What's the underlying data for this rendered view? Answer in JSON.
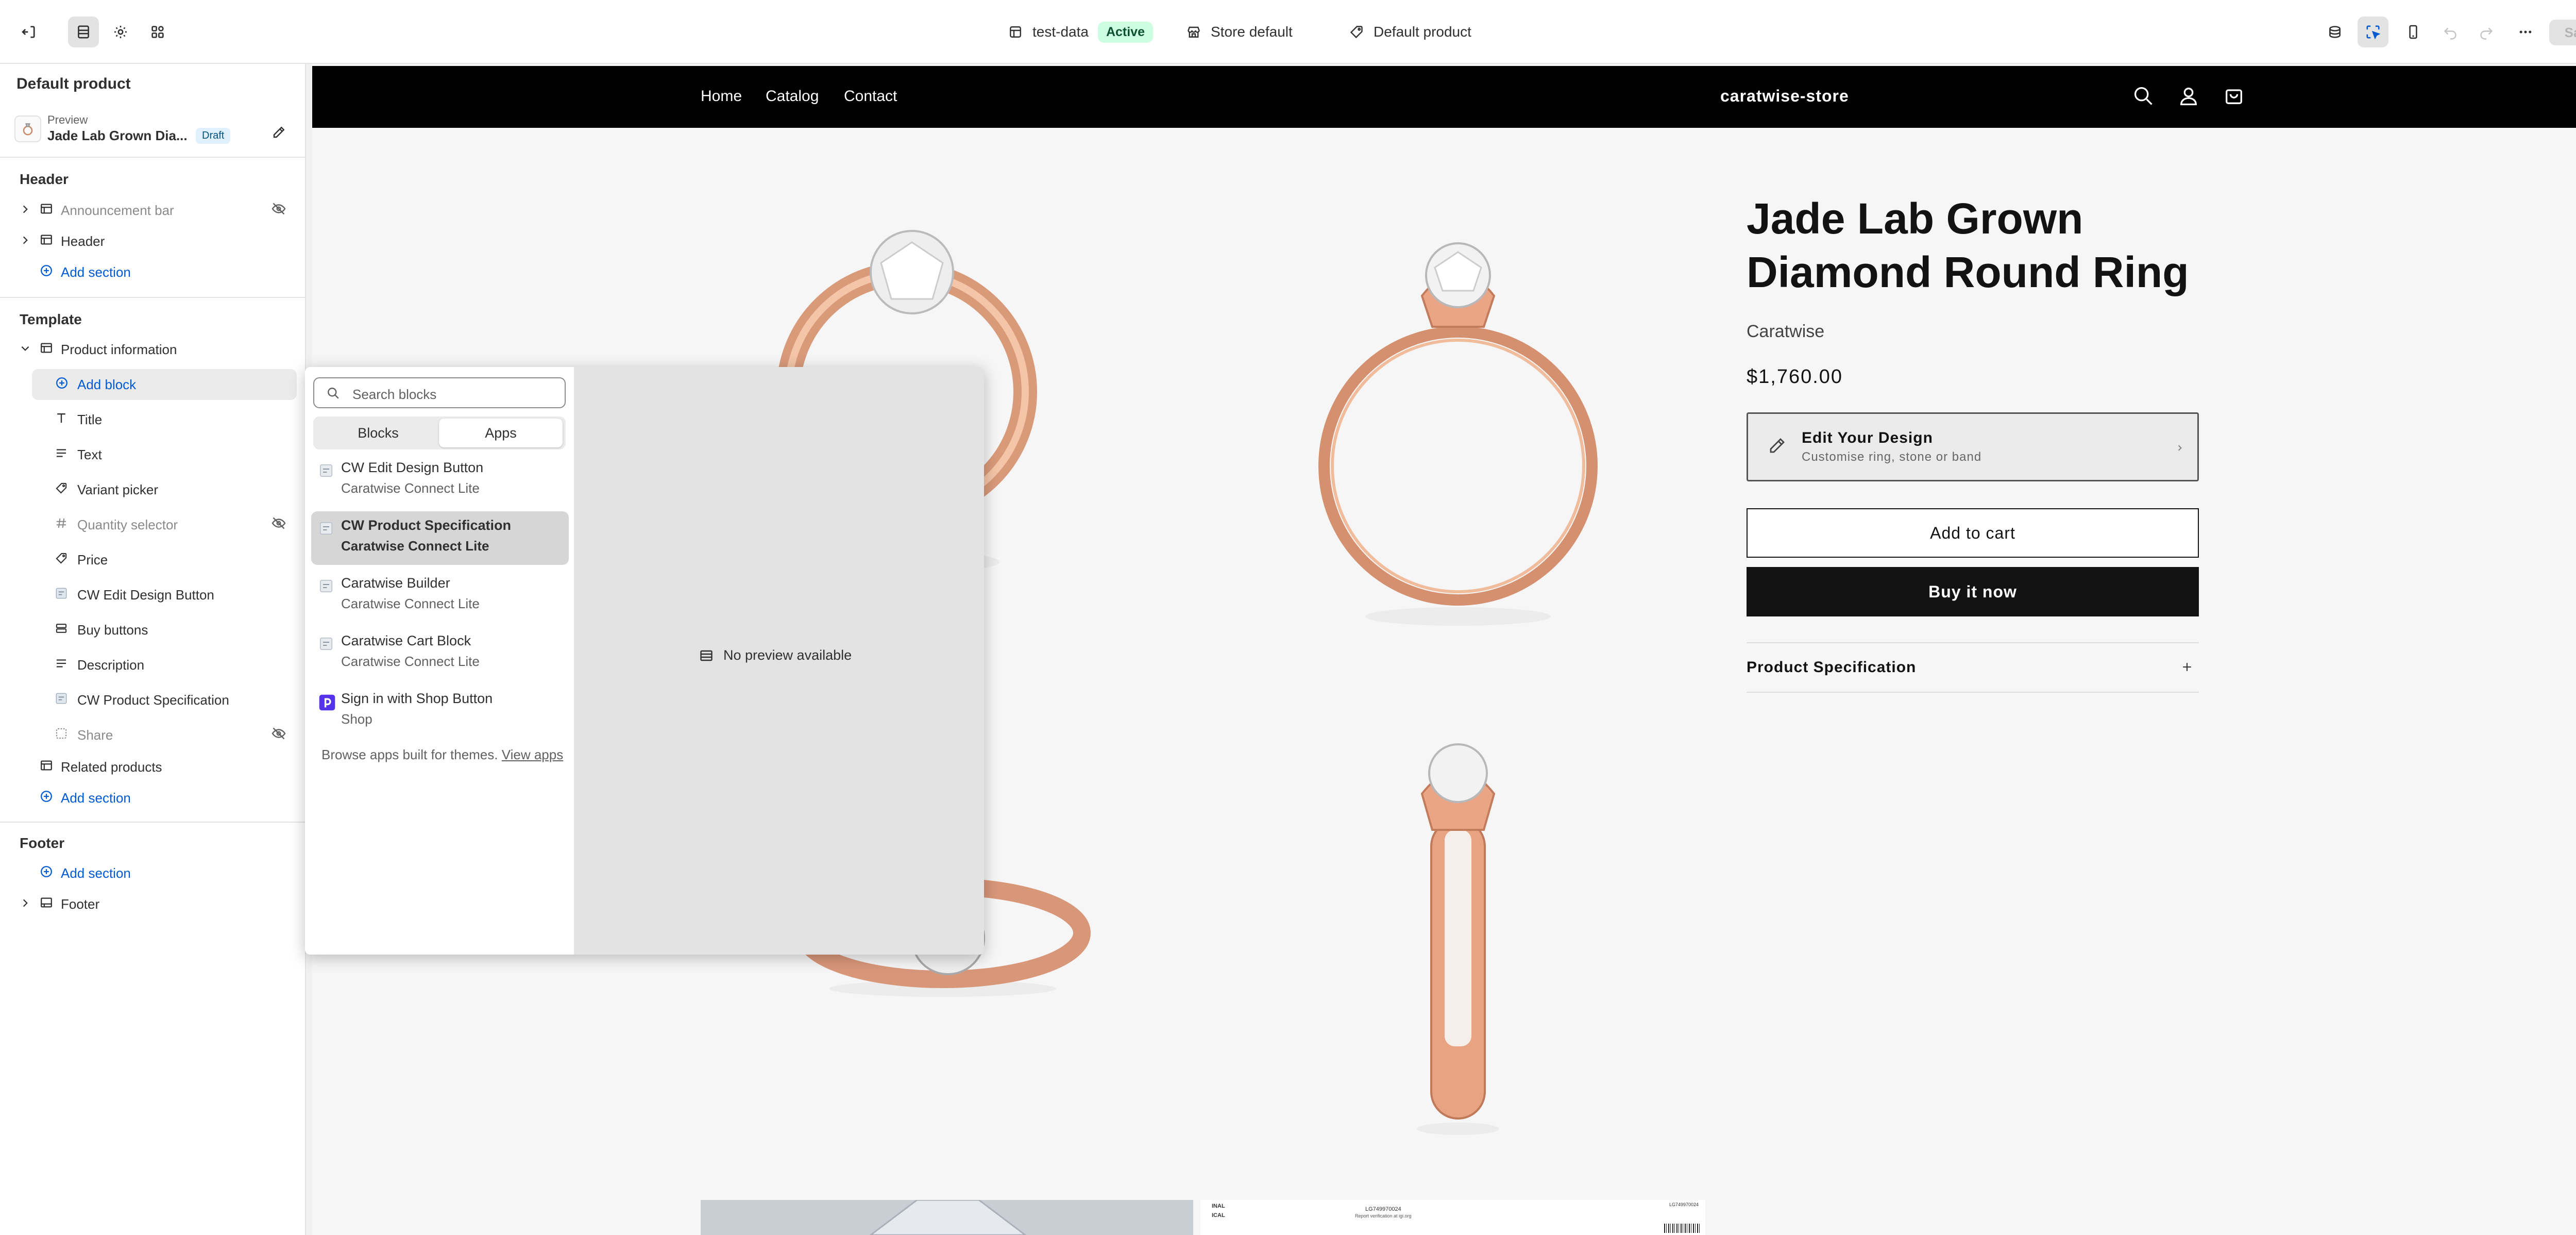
{
  "topbar": {
    "theme_name": "test-data",
    "theme_status": "Active",
    "store_label": "Store default",
    "template_label": "Default product",
    "save_label": "Save"
  },
  "sidebar": {
    "title": "Default product",
    "preview_label": "Preview",
    "preview_product": "Jade Lab Grown Dia...",
    "preview_status": "Draft",
    "header_section": {
      "heading": "Header",
      "items": [
        "Announcement bar",
        "Header"
      ],
      "add_section": "Add section"
    },
    "template_section": {
      "heading": "Template",
      "product_information": "Product information",
      "add_block": "Add block",
      "blocks": [
        "Title",
        "Text",
        "Variant picker",
        "Quantity selector",
        "Price",
        "CW Edit Design Button",
        "Buy buttons",
        "Description",
        "CW Product Specification",
        "Share"
      ],
      "related_products": "Related products",
      "add_section": "Add section"
    },
    "footer_section": {
      "heading": "Footer",
      "add_section": "Add section",
      "items": [
        "Footer"
      ]
    }
  },
  "store": {
    "nav": [
      "Home",
      "Catalog",
      "Contact"
    ],
    "name": "caratwise-store",
    "product_title": "Jade Lab Grown Diamond Round Ring",
    "vendor": "Caratwise",
    "price": "$1,760.00",
    "edit_title": "Edit Your Design",
    "edit_subtitle": "Customise ring, stone or band",
    "add_to_cart": "Add to cart",
    "buy_now": "Buy it now",
    "spec_label": "Product Specification",
    "cert_lines": [
      "INAL",
      "ICAL",
      "LG749970024",
      "Report verification at igi.org",
      "LG749970024"
    ]
  },
  "picker": {
    "search_placeholder": "Search blocks",
    "tabs": [
      "Blocks",
      "Apps"
    ],
    "items": [
      {
        "name": "CW Edit Design Button",
        "app": "Caratwise Connect Lite"
      },
      {
        "name": "CW Product Specification",
        "app": "Caratwise Connect Lite"
      },
      {
        "name": "Caratwise Builder",
        "app": "Caratwise Connect Lite"
      },
      {
        "name": "Caratwise Cart Block",
        "app": "Caratwise Connect Lite"
      },
      {
        "name": "Sign in with Shop Button",
        "app": "Shop"
      }
    ],
    "browse_text": "Browse apps built for themes.",
    "browse_link": "View apps",
    "no_preview": "No preview available"
  }
}
